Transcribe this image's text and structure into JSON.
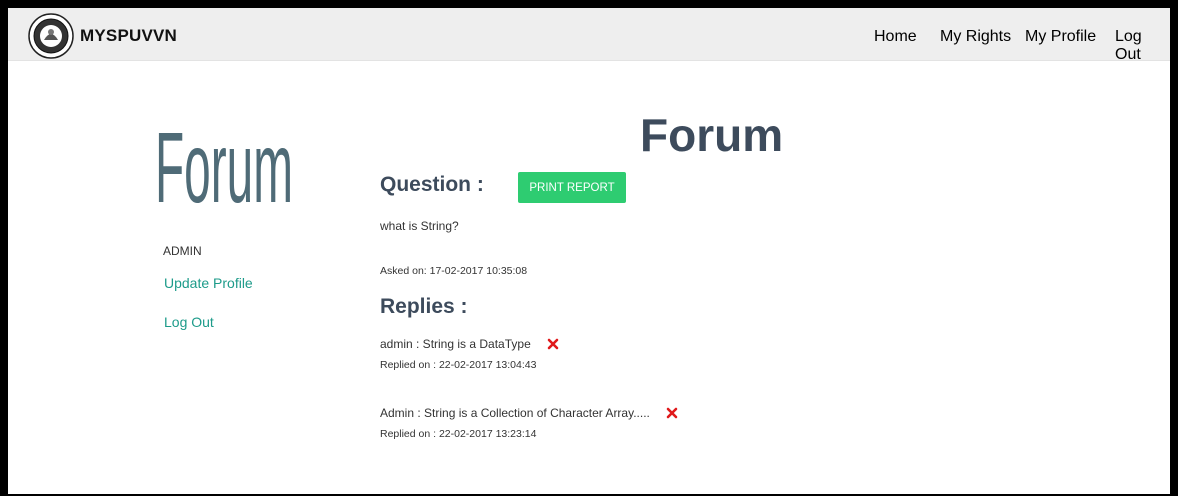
{
  "header": {
    "brand": "MYSPUVVN",
    "nav": {
      "home": "Home",
      "rights": "My Rights",
      "profile": "My Profile",
      "logout": "Log Out"
    }
  },
  "sidebar": {
    "logo_text": "Forum",
    "user": "ADMIN",
    "update_profile": "Update Profile",
    "logout": "Log Out"
  },
  "main": {
    "title": "Forum",
    "question_heading": "Question :",
    "print_button": "PRINT REPORT",
    "question_text": "what is String?",
    "asked_on": "Asked on: 17-02-2017 10:35:08",
    "replies_heading": "Replies :",
    "replies": [
      {
        "text": "admin : String is a DataType",
        "date": "Replied on : 22-02-2017 13:04:43"
      },
      {
        "text": "Admin : String is a Collection of Character Array.....",
        "date": "Replied on : 22-02-2017 13:23:14"
      }
    ]
  },
  "colors": {
    "accent_green": "#2ecc71",
    "link_teal": "#1d9b8a",
    "heading": "#3d4b5c",
    "delete_red": "#e0191b"
  }
}
